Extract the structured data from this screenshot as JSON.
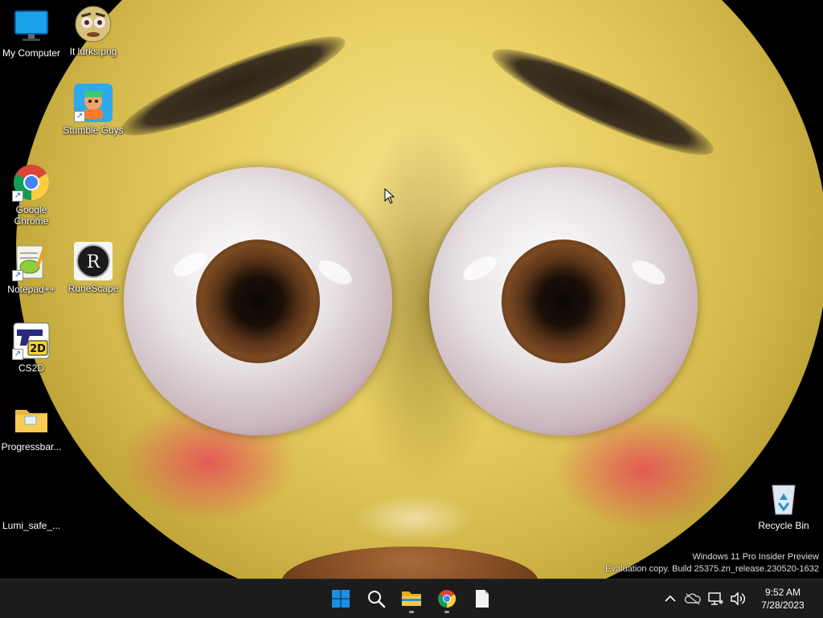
{
  "desktop": {
    "icons": [
      {
        "label": "My Computer",
        "icon": "monitor-icon"
      },
      {
        "label": "It lurks.png",
        "icon": "image-file-icon"
      },
      {
        "label": "Stumble Guys",
        "icon": "stumble-guys-icon"
      },
      {
        "label": "Google Chrome",
        "icon": "chrome-icon"
      },
      {
        "label": "Notepad++",
        "icon": "notepad-plus-plus-icon"
      },
      {
        "label": "RuneScape",
        "icon": "runescape-icon"
      },
      {
        "label": "CS2D",
        "icon": "cs2d-icon"
      },
      {
        "label": "Progressbar...",
        "icon": "folder-icon"
      },
      {
        "label": "Lumi_safe_...",
        "icon": "black-file-icon"
      },
      {
        "label": "Recycle Bin",
        "icon": "recycle-bin-icon"
      }
    ]
  },
  "watermark": {
    "line1": "Windows 11 Pro Insider Preview",
    "line2": "Evaluation copy. Build 25375.zn_release.230520-1632"
  },
  "taskbar": {
    "pinned": [
      {
        "name": "start",
        "icon": "windows-logo-icon"
      },
      {
        "name": "search",
        "icon": "search-icon"
      },
      {
        "name": "file-explorer",
        "icon": "file-explorer-icon"
      },
      {
        "name": "chrome",
        "icon": "chrome-icon"
      },
      {
        "name": "notepad",
        "icon": "blank-document-icon"
      }
    ],
    "tray_icons": [
      "chevron-up-icon",
      "cloud-off-icon",
      "network-icon",
      "volume-icon"
    ],
    "clock": {
      "time": "9:52 AM",
      "date": "7/28/2023"
    }
  },
  "colors": {
    "taskbar_bg": "#1c1c1c",
    "face_yellow": "#e9cf62",
    "accent_blue": "#0078d4"
  }
}
